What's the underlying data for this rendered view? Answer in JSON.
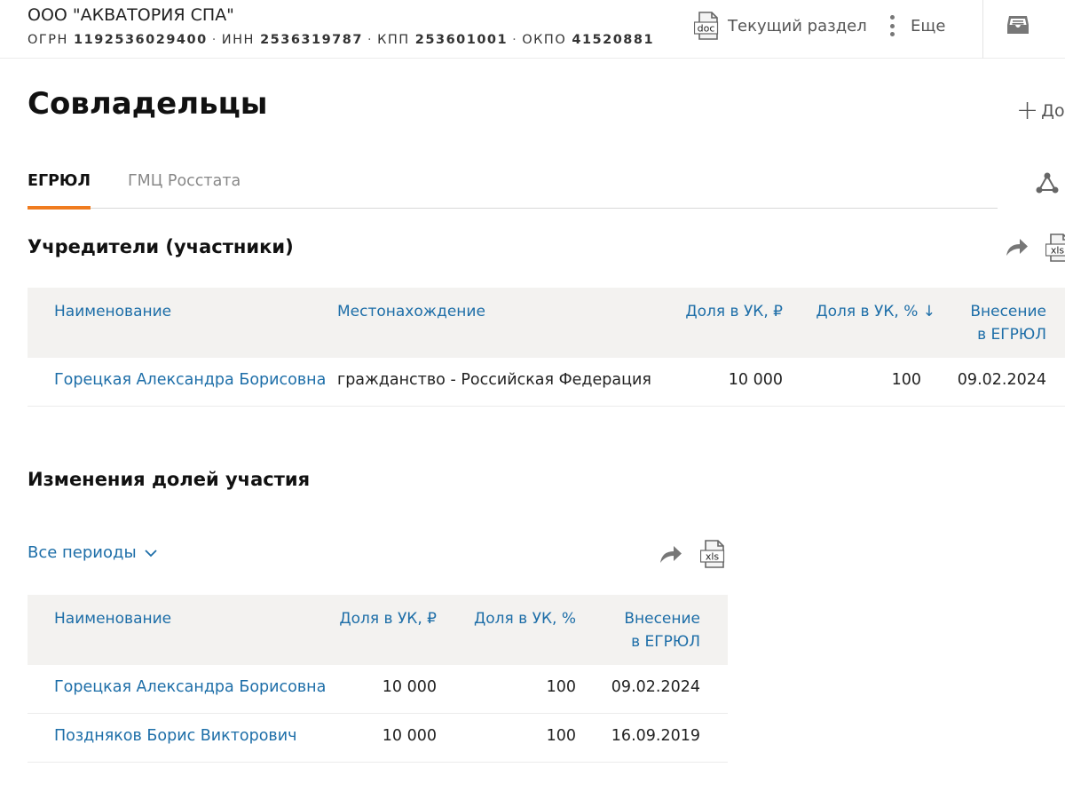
{
  "company": {
    "name": "ООО \"АКВАТОРИЯ СПА\"",
    "ogrn_label": "ОГРН",
    "ogrn": "1192536029400",
    "inn_label": "ИНН",
    "inn": "2536319787",
    "kpp_label": "КПП",
    "kpp": "253601001",
    "okpo_label": "ОКПО",
    "okpo": "41520881"
  },
  "header": {
    "doc_icon_text": "doc",
    "current_section_label": "Текущий раздел",
    "more_label": "Еще"
  },
  "page": {
    "title": "Совладельцы",
    "add_label": "До"
  },
  "tabs": [
    {
      "label": "ЕГРЮЛ",
      "active": true
    },
    {
      "label": "ГМЦ Росстата",
      "active": false
    }
  ],
  "founders": {
    "title": "Учредители (участники)",
    "xls_icon_text": "xls",
    "columns": {
      "name": "Наименование",
      "location": "Местонахождение",
      "share_rub": "Доля в УК, ₽",
      "share_pct": "Доля в УК, % ↓",
      "entry_line1": "Внесение",
      "entry_line2": "в ЕГРЮЛ"
    },
    "rows": [
      {
        "name": "Горецкая Александра Борисовна",
        "location": "гражданство - Российская Федерация",
        "share_rub": "10 000",
        "share_pct": "100",
        "entry_date": "09.02.2024"
      }
    ]
  },
  "changes": {
    "title": "Изменения долей участия",
    "period_label": "Все периоды",
    "xls_icon_text": "xls",
    "columns": {
      "name": "Наименование",
      "share_rub": "Доля в УК, ₽",
      "share_pct": "Доля в УК, %",
      "entry_line1": "Внесение",
      "entry_line2": "в ЕГРЮЛ"
    },
    "rows": [
      {
        "name": "Горецкая Александра Борисовна",
        "share_rub": "10 000",
        "share_pct": "100",
        "entry_date": "09.02.2024"
      },
      {
        "name": "Поздняков Борис Викторович",
        "share_rub": "10 000",
        "share_pct": "100",
        "entry_date": "16.09.2019"
      }
    ]
  },
  "colors": {
    "accent": "#f07c1f",
    "link": "#1d6ea8",
    "table_header_bg": "#f3f2f0"
  }
}
